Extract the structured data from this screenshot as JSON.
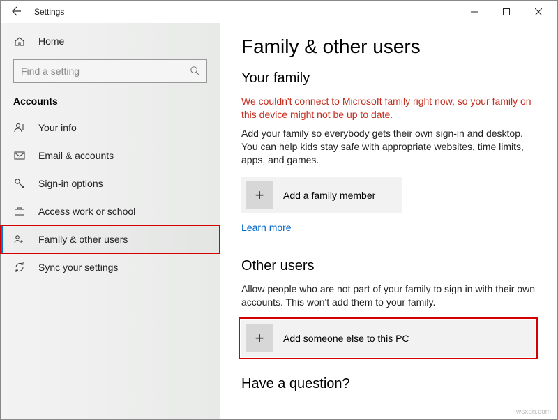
{
  "titlebar": {
    "app_name": "Settings"
  },
  "sidebar": {
    "home": "Home",
    "search_placeholder": "Find a setting",
    "section": "Accounts",
    "items": [
      {
        "label": "Your info"
      },
      {
        "label": "Email & accounts"
      },
      {
        "label": "Sign-in options"
      },
      {
        "label": "Access work or school"
      },
      {
        "label": "Family & other users"
      },
      {
        "label": "Sync your settings"
      }
    ]
  },
  "main": {
    "title": "Family & other users",
    "family": {
      "heading": "Your family",
      "error": "We couldn't connect to Microsoft family right now, so your family on this device might not be up to date.",
      "desc": "Add your family so everybody gets their own sign-in and desktop. You can help kids stay safe with appropriate websites, time limits, apps, and games.",
      "add_label": "Add a family member",
      "learn_more": "Learn more"
    },
    "other": {
      "heading": "Other users",
      "desc": "Allow people who are not part of your family to sign in with their own accounts. This won't add them to your family.",
      "add_label": "Add someone else to this PC"
    },
    "question_heading": "Have a question?"
  },
  "watermark": "wsxdn.com"
}
